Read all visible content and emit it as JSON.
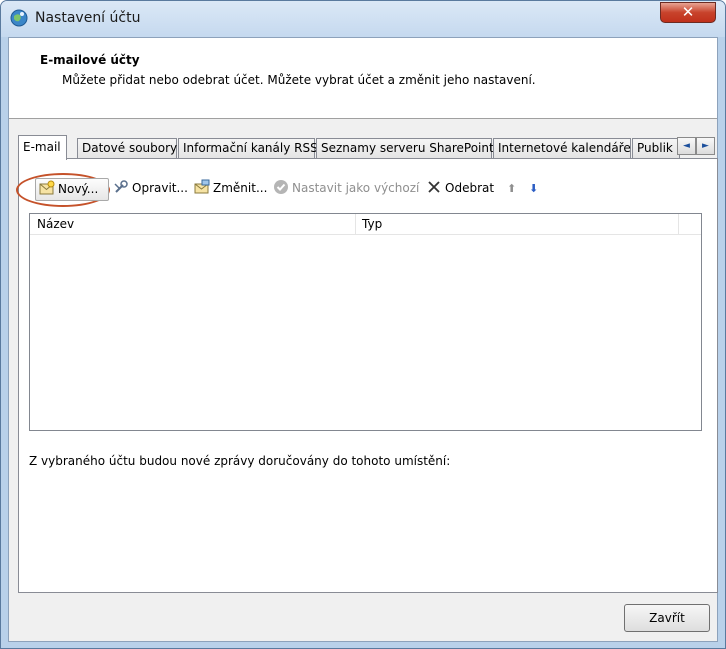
{
  "window": {
    "title": "Nastavení účtu",
    "close_glyph": "✕"
  },
  "header": {
    "title": "E-mailové účty",
    "description": "Můžete přidat nebo odebrat účet. Můžete vybrat účet a změnit jeho nastavení."
  },
  "tabs": [
    {
      "label": "E-mail"
    },
    {
      "label": "Datové soubory"
    },
    {
      "label": "Informační kanály RSS"
    },
    {
      "label": "Seznamy serveru SharePoint"
    },
    {
      "label": "Internetové kalendáře"
    },
    {
      "label": "Publik"
    }
  ],
  "tab_scroll": {
    "left": "◄",
    "right": "►"
  },
  "toolbar": {
    "new_label": "Nový...",
    "repair_label": "Opravit...",
    "change_label": "Změnit...",
    "set_default_label": "Nastavit jako výchozí",
    "remove_label": "Odebrat",
    "up_glyph": "⬆",
    "down_glyph": "⬇"
  },
  "list": {
    "columns": [
      "Název",
      "Typ"
    ]
  },
  "delivery_label": "Z vybraného účtu budou nové zprávy doručovány do tohoto umístění:",
  "footer": {
    "close_label": "Zavřít"
  },
  "icons": {
    "app": "outlook-globe-icon",
    "new": "new-account-icon",
    "repair": "repair-icon",
    "change": "change-icon",
    "set_default": "check-icon",
    "remove": "delete-x-icon"
  }
}
